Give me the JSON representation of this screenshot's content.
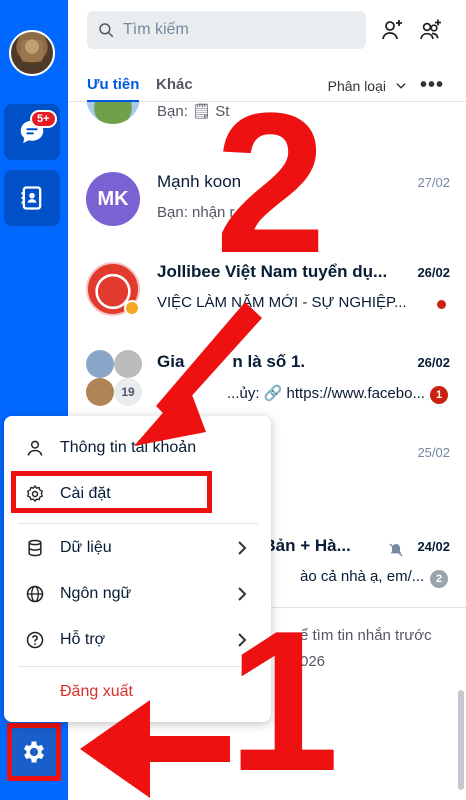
{
  "search": {
    "placeholder": "Tìm kiếm"
  },
  "tabs": {
    "priority": "Ưu tiên",
    "other": "Khác",
    "classify": "Phân loại"
  },
  "rail": {
    "chat_badge": "5+"
  },
  "conversations": [
    {
      "name": "",
      "message": "Bạn: 🗒 St",
      "time": ""
    },
    {
      "name": "Mạnh koon",
      "initials": "MK",
      "message": "Bạn: nhận r",
      "time": "27/02"
    },
    {
      "name": "Jollibee Việt Nam tuyển dụ...",
      "message": "VIỆC LÀM NĂM MỚI - SỰ NGHIỆP...",
      "time": "26/02"
    },
    {
      "name": "Gia",
      "name_suffix": "n là số 1.",
      "message_prefix": "...ủy:",
      "message": "https://www.facebo...",
      "time": "26/02",
      "unread": "1",
      "member_count": "19"
    },
    {
      "name": "",
      "message": "",
      "time": "25/02"
    },
    {
      "name": "t Bản + Hà...",
      "message": "ào cả nhà ạ, em/...",
      "time": "24/02",
      "unread": "2"
    }
  ],
  "footer_hint": {
    "line1": "ể tìm tin nhắn trước",
    "line2": "026"
  },
  "menu": {
    "account": "Thông tin tài khoản",
    "settings": "Cài đặt",
    "data": "Dữ liệu",
    "language": "Ngôn ngữ",
    "support": "Hỗ trợ",
    "logout": "Đăng xuất"
  },
  "annotations": {
    "step1": "1",
    "step2": "2"
  },
  "colors": {
    "rail": "#0068ff",
    "accent": "#005ae0",
    "annotation": "#ee1111"
  }
}
